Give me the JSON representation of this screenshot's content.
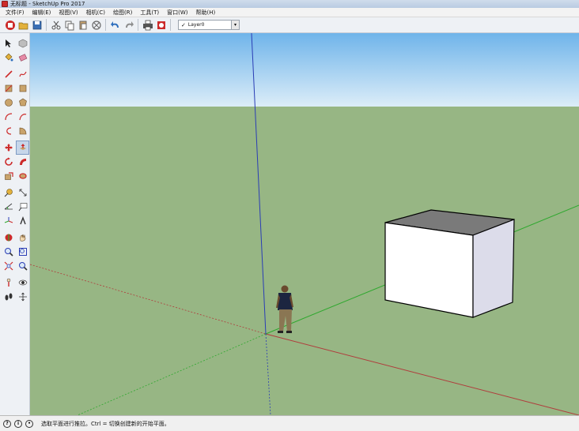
{
  "window": {
    "title": "无标题 - SketchUp Pro 2017"
  },
  "menu": [
    {
      "label": "文件(F)"
    },
    {
      "label": "编辑(E)"
    },
    {
      "label": "视图(V)"
    },
    {
      "label": "相机(C)"
    },
    {
      "label": "绘图(R)"
    },
    {
      "label": "工具(T)"
    },
    {
      "label": "窗口(W)"
    },
    {
      "label": "帮助(H)"
    }
  ],
  "layers": {
    "current": "Layer0"
  },
  "status": {
    "message": "选取平面进行推拉。Ctrl = 切换创建新的开始平面。"
  },
  "colors": {
    "sky_top": "#6fb4ea",
    "sky_bottom": "#dcedf8",
    "ground": "#97b684",
    "axis_red": "#b03c3c",
    "axis_green": "#2fa82f",
    "axis_blue": "#2a3db5",
    "box_top": "#7a7a7a",
    "box_front": "#ffffff",
    "box_side": "#dcdcea",
    "accent_red": "#cc2a2a"
  },
  "icons": {
    "toolbar": [
      "new-file-icon",
      "open-folder-icon",
      "save-icon",
      "cut-icon",
      "copy-icon",
      "paste-icon",
      "erase-icon",
      "undo-icon",
      "redo-icon",
      "print-icon",
      "model-info-icon"
    ],
    "left_tools": [
      "select-icon",
      "component-icon",
      "paint-bucket-icon",
      "eraser-icon",
      "line-icon",
      "freehand-icon",
      "rectangle-icon",
      "rotated-rectangle-icon",
      "circle-icon",
      "polygon-icon",
      "arc-icon",
      "two-point-arc-icon",
      "three-point-arc-icon",
      "pie-icon",
      "move-icon",
      "push-pull-icon",
      "rotate-icon",
      "follow-me-icon",
      "scale-icon",
      "offset-icon",
      "tape-measure-icon",
      "dimension-icon",
      "protractor-icon",
      "text-icon",
      "axes-icon",
      "3d-text-icon",
      "orbit-icon",
      "pan-icon",
      "zoom-icon",
      "zoom-window-icon",
      "zoom-extents-icon",
      "previous-view-icon",
      "position-camera-icon",
      "look-around-icon",
      "walk-icon",
      "section-plane-icon"
    ]
  }
}
